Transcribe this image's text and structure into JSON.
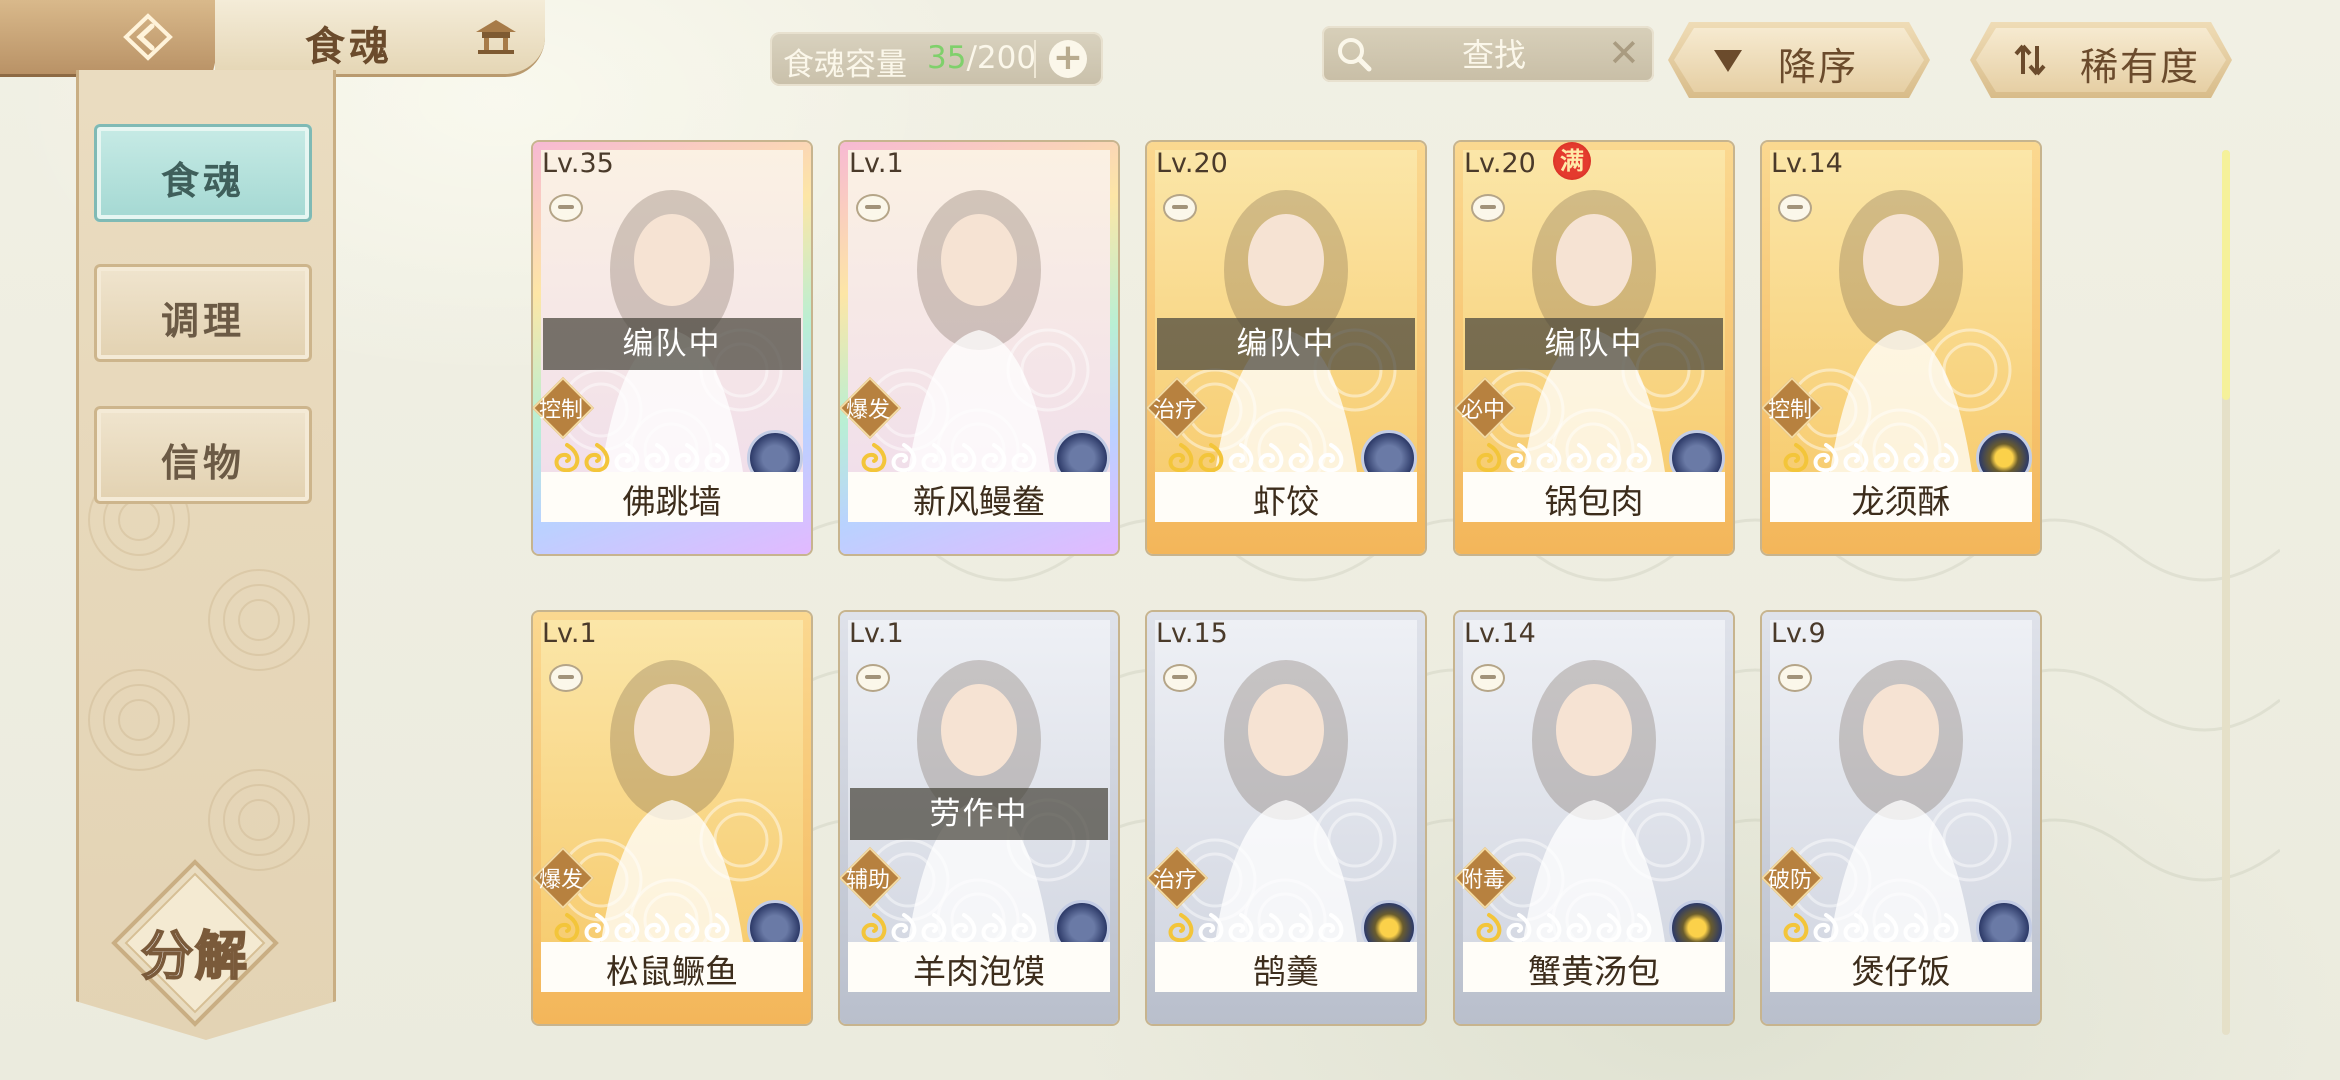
{
  "header": {
    "title": "食魂",
    "capacity": {
      "label": "食魂容量",
      "current": "35",
      "max": "/200"
    },
    "search": {
      "placeholder": "查找"
    },
    "sort_order": "降序",
    "sort_key": "稀有度"
  },
  "sidebar": {
    "tabs": [
      {
        "label": "食魂",
        "active": true
      },
      {
        "label": "调理",
        "active": false
      },
      {
        "label": "信物",
        "active": false
      }
    ],
    "decompose_label": "分解"
  },
  "cards": [
    {
      "level": "Lv.35",
      "name": "佛跳墙",
      "status": "编队中",
      "role": "控制",
      "rarity": "rainbow",
      "stars_filled": 2,
      "orb": "blue",
      "full": ""
    },
    {
      "level": "Lv.1",
      "name": "新风鳗鲞",
      "status": "",
      "role": "爆发",
      "rarity": "rainbow",
      "stars_filled": 1,
      "orb": "blue",
      "full": ""
    },
    {
      "level": "Lv.20",
      "name": "虾饺",
      "status": "编队中",
      "role": "治疗",
      "rarity": "gold",
      "stars_filled": 2,
      "orb": "blue",
      "full": ""
    },
    {
      "level": "Lv.20",
      "name": "锅包肉",
      "status": "编队中",
      "role": "必中",
      "rarity": "gold",
      "stars_filled": 1,
      "orb": "blue",
      "full": "满"
    },
    {
      "level": "Lv.14",
      "name": "龙须酥",
      "status": "",
      "role": "控制",
      "rarity": "gold",
      "stars_filled": 1,
      "orb": "gold",
      "full": ""
    },
    {
      "level": "Lv.1",
      "name": "松鼠鳜鱼",
      "status": "",
      "role": "爆发",
      "rarity": "gold",
      "stars_filled": 1,
      "orb": "blue",
      "full": ""
    },
    {
      "level": "Lv.1",
      "name": "羊肉泡馍",
      "status": "劳作中",
      "role": "辅助",
      "rarity": "silver",
      "stars_filled": 1,
      "orb": "blue",
      "full": ""
    },
    {
      "level": "Lv.15",
      "name": "鹄羹",
      "status": "",
      "role": "治疗",
      "rarity": "silver",
      "stars_filled": 1,
      "orb": "gold",
      "full": ""
    },
    {
      "level": "Lv.14",
      "name": "蟹黄汤包",
      "status": "",
      "role": "附毒",
      "rarity": "silver",
      "stars_filled": 1,
      "orb": "gold",
      "full": ""
    },
    {
      "level": "Lv.9",
      "name": "煲仔饭",
      "status": "",
      "role": "破防",
      "rarity": "silver",
      "stars_filled": 1,
      "orb": "blue",
      "full": ""
    }
  ],
  "colors": {
    "accent_green": "#7fd06b",
    "active_tab": "#a3d8d2",
    "star_filled": "#f3c53a"
  }
}
